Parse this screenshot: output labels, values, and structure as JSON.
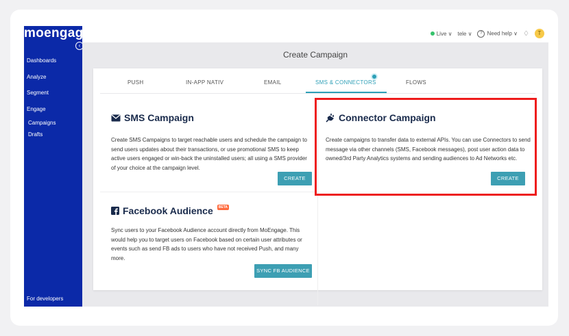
{
  "app": {
    "logo_text": "moengage",
    "collapse_glyph": "‹"
  },
  "sidebar": {
    "items": [
      {
        "label": "Dashboards"
      },
      {
        "label": "Analyze"
      },
      {
        "label": "Segment"
      },
      {
        "label": "Engage"
      }
    ],
    "sub_items": [
      {
        "label": "Campaigns"
      },
      {
        "label": "Drafts"
      }
    ],
    "footer_label": "For developers"
  },
  "topbar": {
    "live_label": "Live ∨",
    "workspace_label": "tele ∨",
    "help_label": "Need help ∨",
    "avatar_initial": "T"
  },
  "page": {
    "title": "Create Campaign"
  },
  "tabs": [
    {
      "label": "PUSH"
    },
    {
      "label": "IN-APP NATIV"
    },
    {
      "label": "EMAIL"
    },
    {
      "label": "SMS & CONNECTORS",
      "active": true
    },
    {
      "label": "FLOWS"
    }
  ],
  "sms": {
    "title": "SMS Campaign",
    "description": "Create SMS Campaigns to target reachable users and schedule the campaign to send users updates about their transactions, or use promotional SMS to keep active users engaged or win-back the uninstalled users; all using a SMS provider of your choice at the campaign level.",
    "button": "CREATE"
  },
  "connector": {
    "title": "Connector Campaign",
    "description": "Create campaigns to transfer data to external APIs. You can use Connectors to send message via other channels (SMS, Facebook messages), post user action data to owned/3rd Party Analytics systems and sending audiences to Ad Networks etc.",
    "button": "CREATE"
  },
  "facebook": {
    "title": "Facebook Audience",
    "badge": "BETA",
    "description": "Sync users to your Facebook Audience account directly from MoEngage. This would help you to target users on Facebook based on certain user attributes or events such as send FB ads to users who have not received Push, and many more.",
    "button": "SYNC FB AUDIENCE"
  },
  "colors": {
    "sidebar": "#0b29a8",
    "accent": "#3d9fb3",
    "highlight": "#ee1c1c",
    "title": "#1a2b4c"
  },
  "icons": {
    "sms": "envelope-icon",
    "connector": "plug-icon",
    "facebook": "facebook-icon"
  }
}
